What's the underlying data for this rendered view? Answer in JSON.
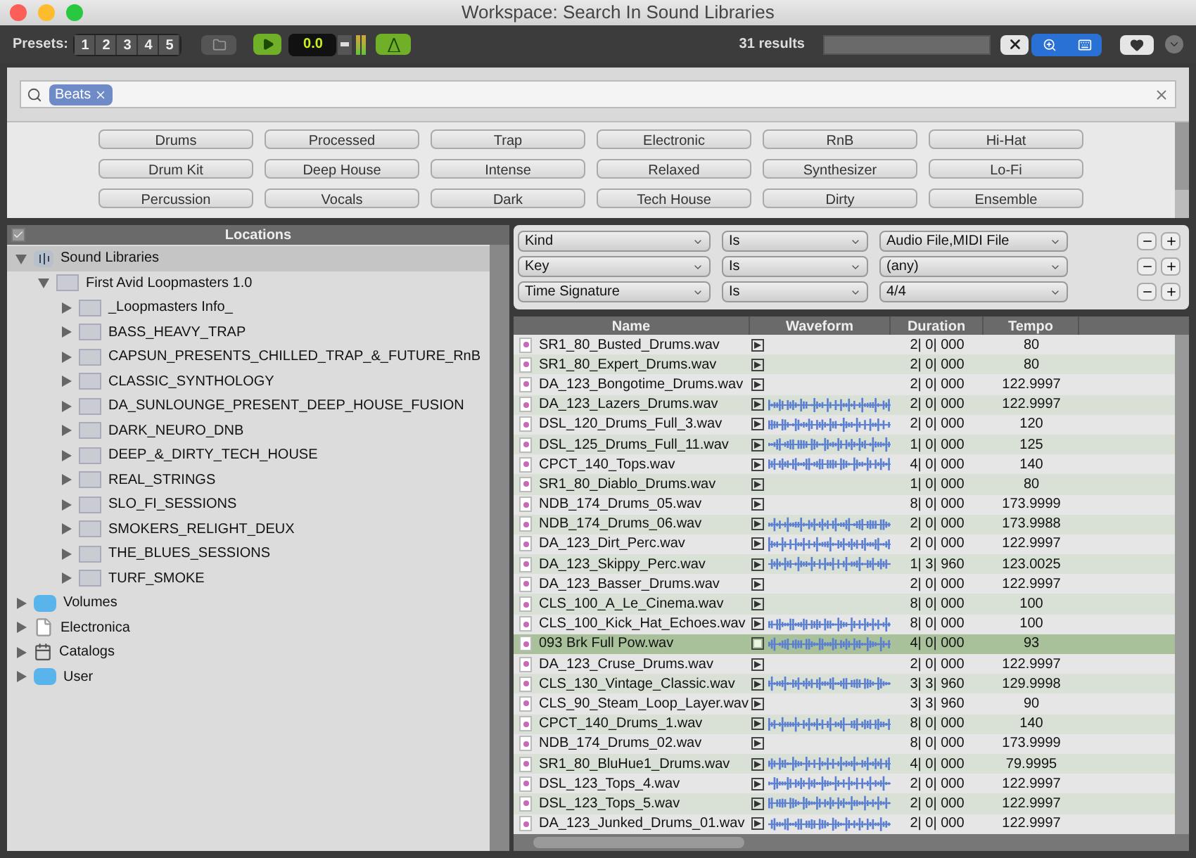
{
  "window": {
    "title": "Workspace: Search In Sound Libraries"
  },
  "toolbar": {
    "presets_label": "Presets:",
    "presets": [
      "1",
      "2",
      "3",
      "4",
      "5"
    ],
    "counter": "0.0",
    "results": "31 results"
  },
  "search": {
    "tokens": [
      "Beats"
    ]
  },
  "tags": [
    "Drums",
    "Processed",
    "Trap",
    "Electronic",
    "RnB",
    "Hi-Hat",
    "Drum Kit",
    "Deep House",
    "Intense",
    "Relaxed",
    "Synthesizer",
    "Lo-Fi",
    "Percussion",
    "Vocals",
    "Dark",
    "Tech House",
    "Dirty",
    "Ensemble"
  ],
  "locations": {
    "title": "Locations",
    "checked": true,
    "tree": [
      {
        "label": "Sound Libraries",
        "kind": "library",
        "expanded": true,
        "selected": true,
        "children": [
          {
            "label": "First Avid Loopmasters 1.0",
            "kind": "folder",
            "expanded": true,
            "selected": false,
            "children": [
              {
                "label": "_Loopmasters Info_",
                "kind": "folder",
                "expanded": false,
                "selected": false
              },
              {
                "label": "BASS_HEAVY_TRAP",
                "kind": "folder",
                "expanded": false,
                "selected": false
              },
              {
                "label": "CAPSUN_PRESENTS_CHILLED_TRAP_&_FUTURE_RnB",
                "kind": "folder",
                "expanded": false,
                "selected": false
              },
              {
                "label": "CLASSIC_SYNTHOLOGY",
                "kind": "folder",
                "expanded": false,
                "selected": false
              },
              {
                "label": "DA_SUNLOUNGE_PRESENT_DEEP_HOUSE_FUSION",
                "kind": "folder",
                "expanded": false,
                "selected": false
              },
              {
                "label": "DARK_NEURO_DNB",
                "kind": "folder",
                "expanded": false,
                "selected": false
              },
              {
                "label": "DEEP_&_DIRTY_TECH_HOUSE",
                "kind": "folder",
                "expanded": false,
                "selected": false
              },
              {
                "label": "REAL_STRINGS",
                "kind": "folder",
                "expanded": false,
                "selected": false
              },
              {
                "label": "SLO_FI_SESSIONS",
                "kind": "folder",
                "expanded": false,
                "selected": false
              },
              {
                "label": "SMOKERS_RELIGHT_DEUX",
                "kind": "folder",
                "expanded": false,
                "selected": false
              },
              {
                "label": "THE_BLUES_SESSIONS",
                "kind": "folder",
                "expanded": false,
                "selected": false
              },
              {
                "label": "TURF_SMOKE",
                "kind": "folder",
                "expanded": false,
                "selected": false
              }
            ]
          }
        ]
      },
      {
        "label": "Volumes",
        "kind": "volume",
        "expanded": false,
        "selected": false
      },
      {
        "label": "Electronica",
        "kind": "file",
        "expanded": false,
        "selected": false
      },
      {
        "label": "Catalogs",
        "kind": "catalog",
        "expanded": false,
        "selected": false
      },
      {
        "label": "User",
        "kind": "volume",
        "expanded": false,
        "selected": false
      }
    ]
  },
  "filters": [
    {
      "field": "Kind",
      "operator": "Is",
      "value": "Audio File,MIDI File"
    },
    {
      "field": "Key",
      "operator": "Is",
      "value": "(any)"
    },
    {
      "field": "Time Signature",
      "operator": "Is",
      "value": "4/4"
    }
  ],
  "table": {
    "columns": [
      "Name",
      "Waveform",
      "Duration",
      "Tempo"
    ],
    "rows": [
      {
        "name": "SR1_80_Busted_Drums.wav",
        "duration": "2| 0| 000",
        "tempo": "80",
        "waveform": false,
        "selected": false
      },
      {
        "name": "SR1_80_Expert_Drums.wav",
        "duration": "2| 0| 000",
        "tempo": "80",
        "waveform": false,
        "selected": false
      },
      {
        "name": "DA_123_Bongotime_Drums.wav",
        "duration": "2| 0| 000",
        "tempo": "122.9997",
        "waveform": false,
        "selected": false
      },
      {
        "name": "DA_123_Lazers_Drums.wav",
        "duration": "2| 0| 000",
        "tempo": "122.9997",
        "waveform": true,
        "selected": false
      },
      {
        "name": "DSL_120_Drums_Full_3.wav",
        "duration": "2| 0| 000",
        "tempo": "120",
        "waveform": true,
        "selected": false
      },
      {
        "name": "DSL_125_Drums_Full_11.wav",
        "duration": "1| 0| 000",
        "tempo": "125",
        "waveform": true,
        "selected": false
      },
      {
        "name": "CPCT_140_Tops.wav",
        "duration": "4| 0| 000",
        "tempo": "140",
        "waveform": true,
        "selected": false
      },
      {
        "name": "SR1_80_Diablo_Drums.wav",
        "duration": "1| 0| 000",
        "tempo": "80",
        "waveform": false,
        "selected": false
      },
      {
        "name": "NDB_174_Drums_05.wav",
        "duration": "8| 0| 000",
        "tempo": "173.9999",
        "waveform": false,
        "selected": false
      },
      {
        "name": "NDB_174_Drums_06.wav",
        "duration": "2| 0| 000",
        "tempo": "173.9988",
        "waveform": true,
        "selected": false
      },
      {
        "name": "DA_123_Dirt_Perc.wav",
        "duration": "2| 0| 000",
        "tempo": "122.9997",
        "waveform": true,
        "selected": false
      },
      {
        "name": "DA_123_Skippy_Perc.wav",
        "duration": "1| 3| 960",
        "tempo": "123.0025",
        "waveform": true,
        "selected": false
      },
      {
        "name": "DA_123_Basser_Drums.wav",
        "duration": "2| 0| 000",
        "tempo": "122.9997",
        "waveform": false,
        "selected": false
      },
      {
        "name": "CLS_100_A_Le_Cinema.wav",
        "duration": "8| 0| 000",
        "tempo": "100",
        "waveform": false,
        "selected": false
      },
      {
        "name": "CLS_100_Kick_Hat_Echoes.wav",
        "duration": "8| 0| 000",
        "tempo": "100",
        "waveform": true,
        "selected": false
      },
      {
        "name": "093 Brk Full Pow.wav",
        "duration": "4| 0| 000",
        "tempo": "93",
        "waveform": true,
        "selected": true
      },
      {
        "name": "DA_123_Cruse_Drums.wav",
        "duration": "2| 0| 000",
        "tempo": "122.9997",
        "waveform": false,
        "selected": false
      },
      {
        "name": "CLS_130_Vintage_Classic.wav",
        "duration": "3| 3| 960",
        "tempo": "129.9998",
        "waveform": true,
        "selected": false
      },
      {
        "name": "CLS_90_Steam_Loop_Layer.wav",
        "duration": "3| 3| 960",
        "tempo": "90",
        "waveform": false,
        "selected": false
      },
      {
        "name": "CPCT_140_Drums_1.wav",
        "duration": "8| 0| 000",
        "tempo": "140",
        "waveform": true,
        "selected": false
      },
      {
        "name": "NDB_174_Drums_02.wav",
        "duration": "8| 0| 000",
        "tempo": "173.9999",
        "waveform": false,
        "selected": false
      },
      {
        "name": "SR1_80_BluHue1_Drums.wav",
        "duration": "4| 0| 000",
        "tempo": "79.9995",
        "waveform": true,
        "selected": false
      },
      {
        "name": "DSL_123_Tops_4.wav",
        "duration": "2| 0| 000",
        "tempo": "122.9997",
        "waveform": true,
        "selected": false
      },
      {
        "name": "DSL_123_Tops_5.wav",
        "duration": "2| 0| 000",
        "tempo": "122.9997",
        "waveform": true,
        "selected": false
      },
      {
        "name": "DA_123_Junked_Drums_01.wav",
        "duration": "2| 0| 000",
        "tempo": "122.9997",
        "waveform": true,
        "selected": false
      }
    ]
  }
}
